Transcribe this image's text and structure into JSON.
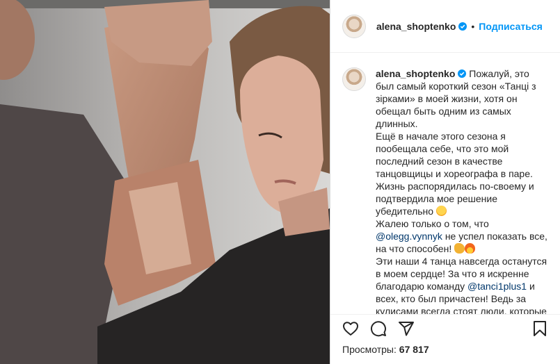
{
  "post": {
    "username": "alena_shoptenko",
    "follow_label": "Подписаться",
    "dot": "•"
  },
  "caption": {
    "username": "alena_shoptenko",
    "part1": " Пожалуй, это был самый короткий сезон «Танці з зірками» в моей жизни, хотя он обещал быть одним из самых длинных.",
    "part2": "Ещё в начале этого сезона я пообещала себе, что это мой последний сезон в качестве танцовщицы и хореографа в паре. Жизнь распорядилась по-своему и подтвердила мое решение убедительно",
    "part3": "Жалею только о том, что",
    "mention1": "@olegg.vynnyk",
    "part4": " не успел показать все, на что способен!",
    "part5": "Эти наши 4 танца навсегда останутся в моем сердце! За что я искренне благодарю команду",
    "mention2": "@tanci1plus1",
    "part6": " и всех, кто был причастен! Ведь за кулисами всегда стоят люди, которые"
  },
  "stats": {
    "views_label": "Просмотры:",
    "views_value": "67 817"
  },
  "icons": {
    "like": "heart-icon",
    "comment": "comment-icon",
    "share": "share-icon",
    "save": "bookmark-icon",
    "verified": "verified-badge-icon"
  },
  "colors": {
    "accent": "#0095f6",
    "mention": "#00376b",
    "text": "#262626"
  }
}
